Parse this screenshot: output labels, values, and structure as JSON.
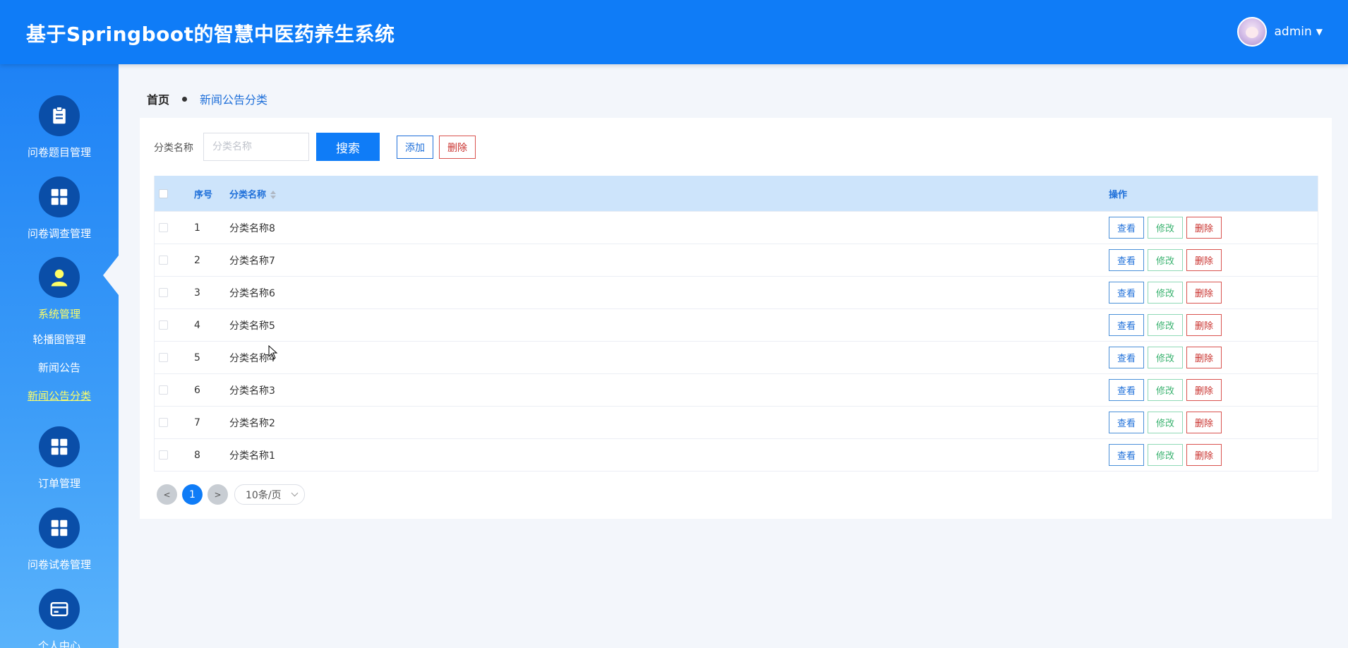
{
  "header": {
    "title": "基于Springboot的智慧中医药养生系统",
    "username": "admin"
  },
  "sidebar": {
    "groups": [
      {
        "label": "问卷题目管理",
        "icon": "clipboard-icon"
      },
      {
        "label": "问卷调查管理",
        "icon": "grid-icon"
      },
      {
        "label": "系统管理",
        "icon": "user-icon"
      },
      {
        "label": "订单管理",
        "icon": "grid-icon"
      },
      {
        "label": "问卷试卷管理",
        "icon": "grid-icon"
      },
      {
        "label": "个人中心",
        "icon": "card-icon"
      }
    ],
    "subitems": [
      "轮播图管理",
      "新闻公告",
      "新闻公告分类"
    ]
  },
  "breadcrumb": {
    "home": "首页",
    "current": "新闻公告分类"
  },
  "search": {
    "label": "分类名称",
    "placeholder": "分类名称",
    "search_button": "搜索",
    "add_button": "添加",
    "delete_button": "删除"
  },
  "table": {
    "headers": {
      "index": "序号",
      "name": "分类名称",
      "operations": "操作"
    },
    "rows": [
      {
        "index": "1",
        "name": "分类名称8"
      },
      {
        "index": "2",
        "name": "分类名称7"
      },
      {
        "index": "3",
        "name": "分类名称6"
      },
      {
        "index": "4",
        "name": "分类名称5"
      },
      {
        "index": "5",
        "name": "分类名称4"
      },
      {
        "index": "6",
        "name": "分类名称3"
      },
      {
        "index": "7",
        "name": "分类名称2"
      },
      {
        "index": "8",
        "name": "分类名称1"
      }
    ],
    "row_actions": {
      "view": "查看",
      "edit": "修改",
      "delete": "删除"
    }
  },
  "pagination": {
    "prev": "<",
    "current_page": "1",
    "next": ">",
    "page_size": "10条/页"
  },
  "colors": {
    "primary": "#0f7cf7",
    "active_nav": "#ffff66",
    "danger": "#c9302c",
    "success": "#3cb371"
  }
}
